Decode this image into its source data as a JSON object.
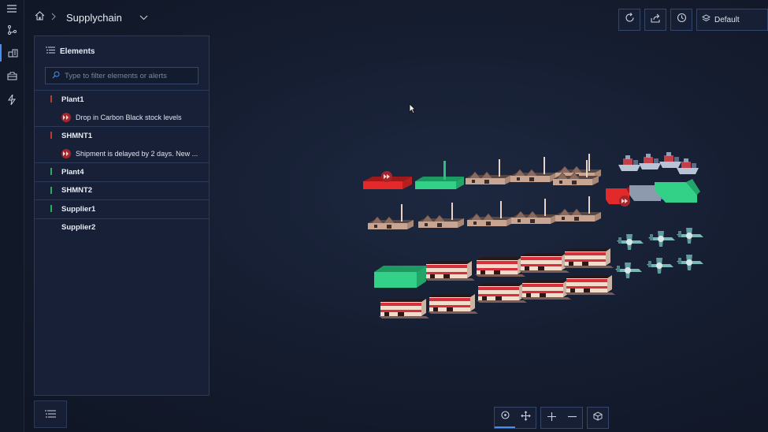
{
  "breadcrumb": {
    "title": "Supplychain"
  },
  "rail": {
    "icons": [
      "menu-icon",
      "graph-icon",
      "buildings-icon",
      "package-icon",
      "lightning-icon"
    ]
  },
  "elements_panel": {
    "title": "Elements",
    "filter_placeholder": "Type to filter elements or alerts",
    "items": [
      {
        "name": "Plant1",
        "status_color": "#c0392b",
        "alert": "Drop in Carbon Black stock levels"
      },
      {
        "name": "SHMNT1",
        "status_color": "#c0392b",
        "alert": "Shipment is delayed by 2 days. New ..."
      },
      {
        "name": "Plant4",
        "status_color": "#27ae60",
        "alert": null
      },
      {
        "name": "SHMNT2",
        "status_color": "#27ae60",
        "alert": null
      },
      {
        "name": "Supplier1",
        "status_color": "#27ae60",
        "alert": null
      },
      {
        "name": "Supplier2",
        "status_color": null,
        "alert": null
      }
    ]
  },
  "toolbar": {
    "layout_label": "Default"
  },
  "colors": {
    "accent": "#4a8df0",
    "alert": "#a3262c",
    "ok": "#27ae60",
    "critical": "#c0392b"
  }
}
